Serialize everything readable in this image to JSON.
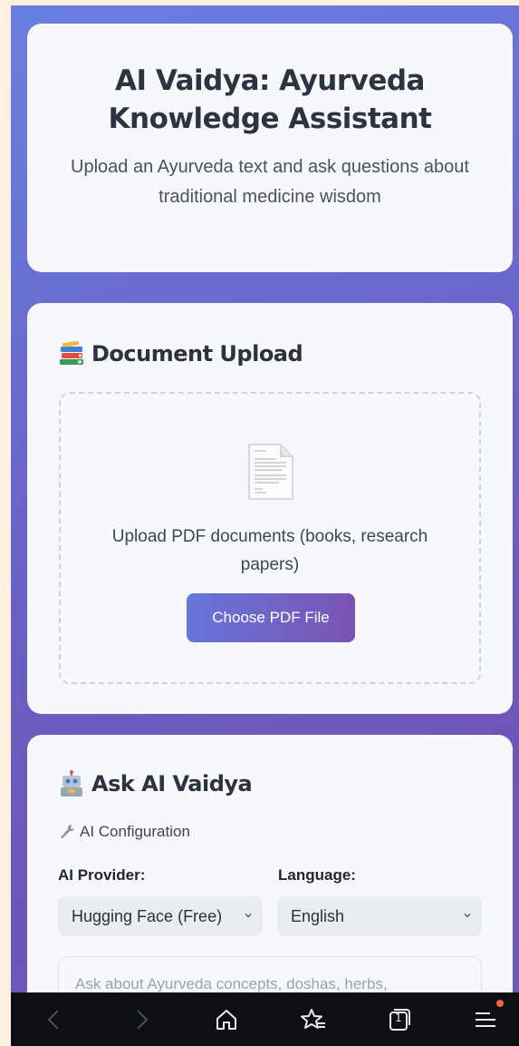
{
  "hero": {
    "title": "AI Vaidya: Ayurveda Knowledge Assistant",
    "subtitle": "Upload an Ayurveda text and ask questions about traditional medicine wisdom"
  },
  "upload": {
    "section_title": "Document Upload",
    "section_icon": "books-icon",
    "hint": "Upload PDF documents (books, research papers)",
    "button_label": "Choose PDF File",
    "dropzone_icon": "document-icon"
  },
  "ask": {
    "section_title": "Ask AI Vaidya",
    "section_icon": "robot-icon",
    "config_label": "AI Configuration",
    "config_icon": "wrench-icon",
    "provider_label": "AI Provider:",
    "provider_value": "Hugging Face (Free)",
    "language_label": "Language:",
    "language_value": "English",
    "question_placeholder": "Ask about Ayurveda concepts, doshas, herbs,"
  },
  "browser_nav": {
    "items": [
      "back-icon",
      "forward-icon",
      "home-icon",
      "bookmark-icon",
      "tabs-icon",
      "menu-icon"
    ],
    "tabs_count": "1"
  },
  "colors": {
    "accent_start": "#6577dc",
    "accent_end": "#7a52b0",
    "background_gradient": "#6a7fe0"
  }
}
